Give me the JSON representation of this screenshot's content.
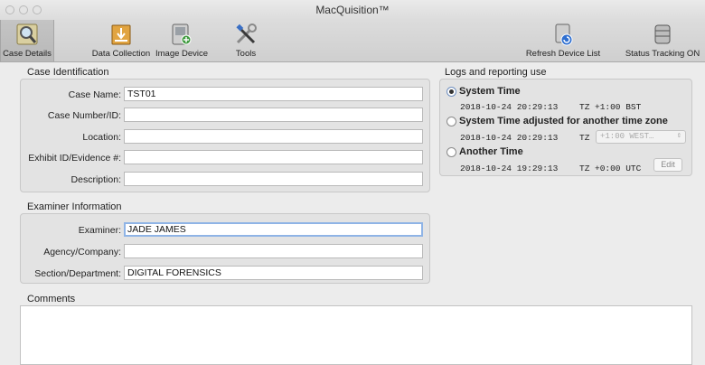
{
  "window": {
    "title": "MacQuisition™"
  },
  "toolbar": {
    "left": [
      {
        "label": "Case Details",
        "icon": "magnifier-icon"
      },
      {
        "label": "Data Collection",
        "icon": "download-box-icon"
      },
      {
        "label": "Image Device",
        "icon": "disk-image-icon"
      },
      {
        "label": "Tools",
        "icon": "wrench-screwdriver-icon"
      }
    ],
    "right": [
      {
        "label": "Refresh Device List",
        "icon": "refresh-device-icon"
      },
      {
        "label": "Status Tracking ON",
        "icon": "database-icon"
      }
    ]
  },
  "case": {
    "title": "Case Identification",
    "fields": [
      {
        "label": "Case Name:",
        "value": "TST01"
      },
      {
        "label": "Case Number/ID:",
        "value": ""
      },
      {
        "label": "Location:",
        "value": ""
      },
      {
        "label": "Exhibit ID/Evidence #:",
        "value": ""
      },
      {
        "label": "Description:",
        "value": ""
      }
    ]
  },
  "examiner": {
    "title": "Examiner Information",
    "fields": [
      {
        "label": "Examiner:",
        "value": "JADE JAMES"
      },
      {
        "label": "Agency/Company:",
        "value": ""
      },
      {
        "label": "Section/Department:",
        "value": "DIGITAL FORENSICS"
      }
    ]
  },
  "logs": {
    "title": "Logs and reporting use",
    "options": [
      {
        "label": "System Time",
        "datetime": "2018-10-24 20:29:13",
        "tz_label": "TZ",
        "tz": "+1:00 BST"
      },
      {
        "label": "System Time adjusted for another time zone",
        "datetime": "2018-10-24 20:29:13",
        "tz_label": "TZ",
        "tz_select": "+1:00  WEST…"
      },
      {
        "label": "Another Time",
        "datetime": "2018-10-24 19:29:13",
        "tz_label": "TZ",
        "tz": "+0:00 UTC",
        "edit_label": "Edit"
      }
    ]
  },
  "comments": {
    "title": "Comments"
  }
}
